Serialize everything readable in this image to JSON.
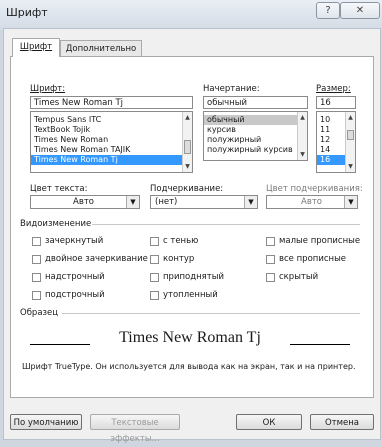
{
  "window": {
    "title": "Шрифт",
    "help_label": "?",
    "close_label": "✕"
  },
  "tabs": [
    {
      "label": "Шрифт"
    },
    {
      "label": "Дополнительно"
    }
  ],
  "font": {
    "label": "Шрифт:",
    "value": "Times New Roman Tj",
    "items": [
      "Tempus Sans ITC",
      "TextBook Tojik",
      "Times New Roman",
      "Times New Roman TAJIK",
      "Times New Roman Tj"
    ],
    "selected_index": 4
  },
  "style": {
    "label": "Начертание:",
    "value": "обычный",
    "items": [
      "обычный",
      "курсив",
      "полужирный",
      "полужирный курсив"
    ],
    "selected_index": 0
  },
  "size": {
    "label": "Размер:",
    "value": "16",
    "items": [
      "10",
      "11",
      "12",
      "14",
      "16"
    ],
    "selected_index": 4
  },
  "text_color": {
    "label": "Цвет текста:",
    "value": "Авто"
  },
  "underline": {
    "label": "Подчеркивание:",
    "value": "(нет)"
  },
  "underline_color": {
    "label": "Цвет подчеркивания:",
    "value": "Авто"
  },
  "effects": {
    "title": "Видоизменение",
    "items": [
      {
        "label": "зачеркнутый"
      },
      {
        "label": "двойное зачеркивание"
      },
      {
        "label": "надстрочный"
      },
      {
        "label": "подстрочный"
      },
      {
        "label": "с тенью"
      },
      {
        "label": "контур"
      },
      {
        "label": "приподнятый"
      },
      {
        "label": "утопленный"
      },
      {
        "label": "малые прописные"
      },
      {
        "label": "все прописные"
      },
      {
        "label": "скрытый"
      }
    ]
  },
  "preview": {
    "title": "Образец",
    "text": "Times New Roman Tj",
    "note": "Шрифт TrueType. Он используется для вывода как на экран, так и на принтер."
  },
  "buttons": {
    "default": "По умолчанию",
    "effects": "Текстовые эффекты...",
    "ok": "ОК",
    "cancel": "Отмена"
  }
}
